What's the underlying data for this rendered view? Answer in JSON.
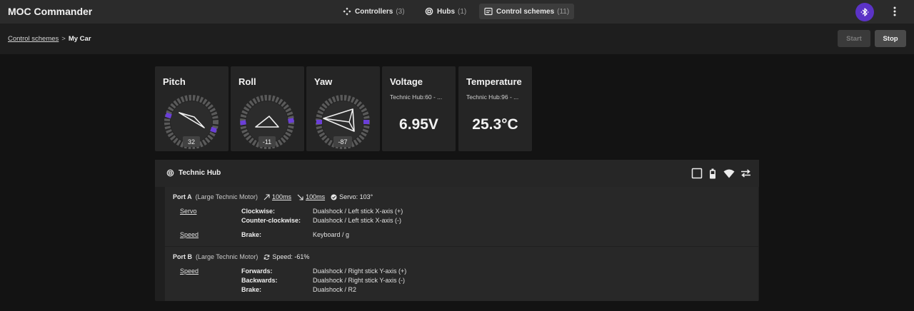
{
  "app": {
    "title": "MOC Commander"
  },
  "nav": {
    "controllers": {
      "label": "Controllers",
      "count": "(3)",
      "icon": "gamepad-icon"
    },
    "hubs": {
      "label": "Hubs",
      "count": "(1)",
      "icon": "hub-icon"
    },
    "schemes": {
      "label": "Control schemes",
      "count": "(11)",
      "icon": "scheme-icon",
      "active": true
    }
  },
  "header_actions": {
    "bluetooth_icon": "bluetooth-icon",
    "more_icon": "more-vert-icon",
    "accent": "#5b33c6"
  },
  "breadcrumb": {
    "parent": "Control schemes",
    "separator": ">",
    "current": "My Car"
  },
  "actions": {
    "start": "Start",
    "stop": "Stop"
  },
  "tiles": {
    "pitch": {
      "title": "Pitch",
      "value": "32"
    },
    "roll": {
      "title": "Roll",
      "value": "-11"
    },
    "yaw": {
      "title": "Yaw",
      "value": "-87"
    },
    "voltage": {
      "title": "Voltage",
      "source": "Technic Hub:60 - ...",
      "value": "6.95V"
    },
    "temperature": {
      "title": "Temperature",
      "source": "Technic Hub:96 - ...",
      "value": "25.3°C"
    }
  },
  "hub": {
    "name": "Technic Hub",
    "tools": [
      "square-outline-icon",
      "battery-icon",
      "wifi-icon",
      "swap-arrows-icon"
    ],
    "ports": [
      {
        "name": "Port A",
        "type": "(Large Technic Motor)",
        "accel": "100ms",
        "decel": "100ms",
        "status": "Servo: 103°",
        "functions": [
          {
            "name": "Servo",
            "bindings": [
              {
                "label": "Clockwise:",
                "value": "Dualshock / Left stick X-axis (+)"
              },
              {
                "label": "Counter-clockwise:",
                "value": "Dualshock / Left stick X-axis (-)"
              }
            ]
          },
          {
            "name": "Speed",
            "bindings": [
              {
                "label": "Brake:",
                "value": "Keyboard / g"
              }
            ]
          }
        ]
      },
      {
        "name": "Port B",
        "type": "(Large Technic Motor)",
        "status": "Speed: -61%",
        "functions": [
          {
            "name": "Speed",
            "bindings": [
              {
                "label": "Forwards:",
                "value": "Dualshock / Right stick Y-axis (+)"
              },
              {
                "label": "Backwards:",
                "value": "Dualshock / Right stick Y-axis (-)"
              },
              {
                "label": "Brake:",
                "value": "Dualshock / R2"
              }
            ]
          }
        ]
      }
    ]
  }
}
